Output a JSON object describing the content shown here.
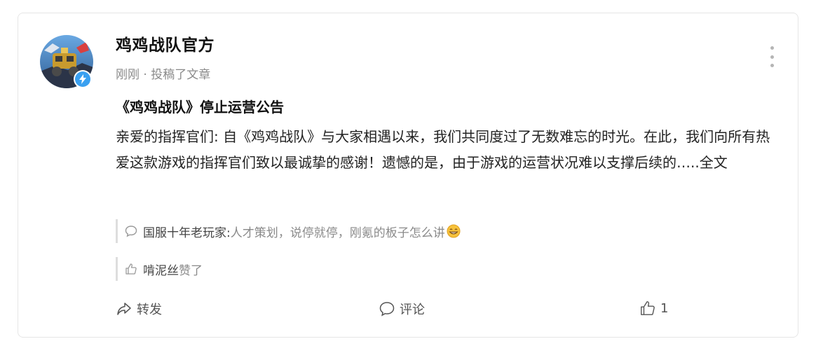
{
  "post": {
    "author": "鸡鸡战队官方",
    "meta": "刚刚 · 投稿了文章",
    "title": "《鸡鸡战队》停止运营公告",
    "body": "亲爱的指挥官们: 自《鸡鸡战队》与大家相遇以来，我们共同度过了无数难忘的时光。在此，我们向所有热爱这款游戏的指挥官们致以最诚挚的感谢！遗憾的是，由于游戏的运营状况难以支撑后续的",
    "read_more": "…..全文"
  },
  "comment_preview": {
    "name": "国服十年老玩家:",
    "text": " 人才策划，说停就停，刚氪的板子怎么讲",
    "emoji": "grinning-face-icon"
  },
  "like_preview": {
    "name": "啃泥丝",
    "text": " 赞了"
  },
  "actions": {
    "share": "转发",
    "comment": "评论",
    "like_count": "1"
  },
  "colors": {
    "verified_badge": "#3aa0f0",
    "muted_text": "#8a8a8a",
    "border": "#e6e6e6"
  }
}
